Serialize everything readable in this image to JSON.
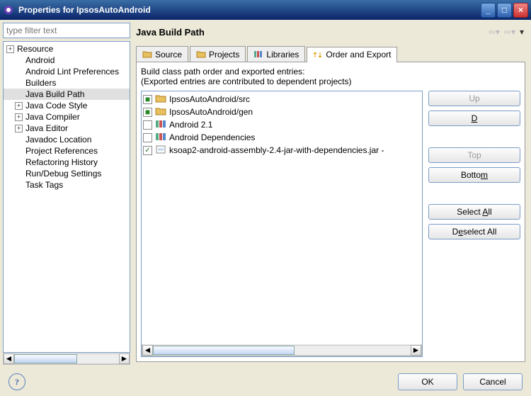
{
  "window": {
    "title": "Properties for IpsosAutoAndroid"
  },
  "filter_placeholder": "type filter text",
  "tree": [
    {
      "exp": "+",
      "label": "Resource",
      "indent": 0
    },
    {
      "exp": "",
      "label": "Android",
      "indent": 1
    },
    {
      "exp": "",
      "label": "Android Lint Preferences",
      "indent": 1
    },
    {
      "exp": "",
      "label": "Builders",
      "indent": 1
    },
    {
      "exp": "",
      "label": "Java Build Path",
      "indent": 1,
      "sel": true
    },
    {
      "exp": "+",
      "label": "Java Code Style",
      "indent": 1
    },
    {
      "exp": "+",
      "label": "Java Compiler",
      "indent": 1
    },
    {
      "exp": "+",
      "label": "Java Editor",
      "indent": 1
    },
    {
      "exp": "",
      "label": "Javadoc Location",
      "indent": 1
    },
    {
      "exp": "",
      "label": "Project References",
      "indent": 1
    },
    {
      "exp": "",
      "label": "Refactoring History",
      "indent": 1
    },
    {
      "exp": "",
      "label": "Run/Debug Settings",
      "indent": 1
    },
    {
      "exp": "",
      "label": "Task Tags",
      "indent": 1
    }
  ],
  "main": {
    "title": "Java Build Path",
    "tabs": {
      "source": "Source",
      "projects": "Projects",
      "libraries": "Libraries",
      "order": "Order and Export"
    },
    "desc1": "Build class path order and exported entries:",
    "desc2": "(Exported entries are contributed to dependent projects)",
    "entries": [
      {
        "checked": true,
        "green": true,
        "icon": "folder",
        "label": "IpsosAutoAndroid/src"
      },
      {
        "checked": true,
        "green": true,
        "icon": "folder",
        "label": "IpsosAutoAndroid/gen"
      },
      {
        "checked": false,
        "green": false,
        "icon": "libs",
        "label": "Android 2.1"
      },
      {
        "checked": false,
        "green": false,
        "icon": "libs",
        "label": "Android Dependencies"
      },
      {
        "checked": true,
        "green": false,
        "icon": "jar",
        "label": "ksoap2-android-assembly-2.4-jar-with-dependencies.jar -"
      }
    ],
    "buttons": {
      "up": "Up",
      "down": "Down",
      "top": "Top",
      "bottom": "Bottom",
      "select_all": "Select All",
      "deselect_all": "Deselect All"
    }
  },
  "footer": {
    "ok": "OK",
    "cancel": "Cancel"
  }
}
